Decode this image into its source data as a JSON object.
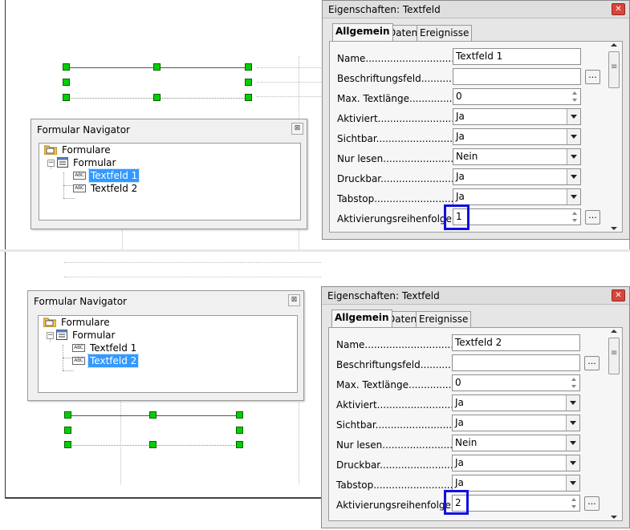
{
  "navigator": {
    "title": "Formular Navigator",
    "root_label": "Formulare",
    "form_label": "Formular",
    "field1": "Textfeld 1",
    "field2": "Textfeld 2",
    "abc": "ABC"
  },
  "properties": {
    "title": "Eigenschaften: Textfeld",
    "tabs": [
      "Allgemein",
      "Daten",
      "Ereignisse"
    ],
    "labels": {
      "name": "Name....................................",
      "caption": "Beschriftungsfeld...............",
      "maxlen": "Max. Textlänge.........................",
      "enabled": "Aktiviert....................................",
      "visible": "Sichtbar.....................................",
      "readonly": "Nur lesen..................................",
      "printable": "Druckbar....................................",
      "tabstop": "Tabstop......................................",
      "taborder": "Aktivierungsreihenfolge..."
    }
  },
  "top_dialog": {
    "name": "Textfeld 1",
    "caption": "",
    "maxlen": "0",
    "enabled": "Ja",
    "visible": "Ja",
    "readonly": "Nein",
    "printable": "Ja",
    "tabstop": "Ja",
    "taborder": "1"
  },
  "bottom_dialog": {
    "name": "Textfeld 2",
    "caption": "",
    "maxlen": "0",
    "enabled": "Ja",
    "visible": "Ja",
    "readonly": "Nein",
    "printable": "Ja",
    "tabstop": "Ja",
    "taborder": "2"
  },
  "icons": {
    "close": "⊠",
    "ellipsis": "...",
    "collapse": "−",
    "window_close": "✕"
  },
  "colors": {
    "selection": "#3399ff",
    "handle": "#00d000",
    "highlight_box": "#1010e0",
    "close_button": "#d9453a"
  }
}
